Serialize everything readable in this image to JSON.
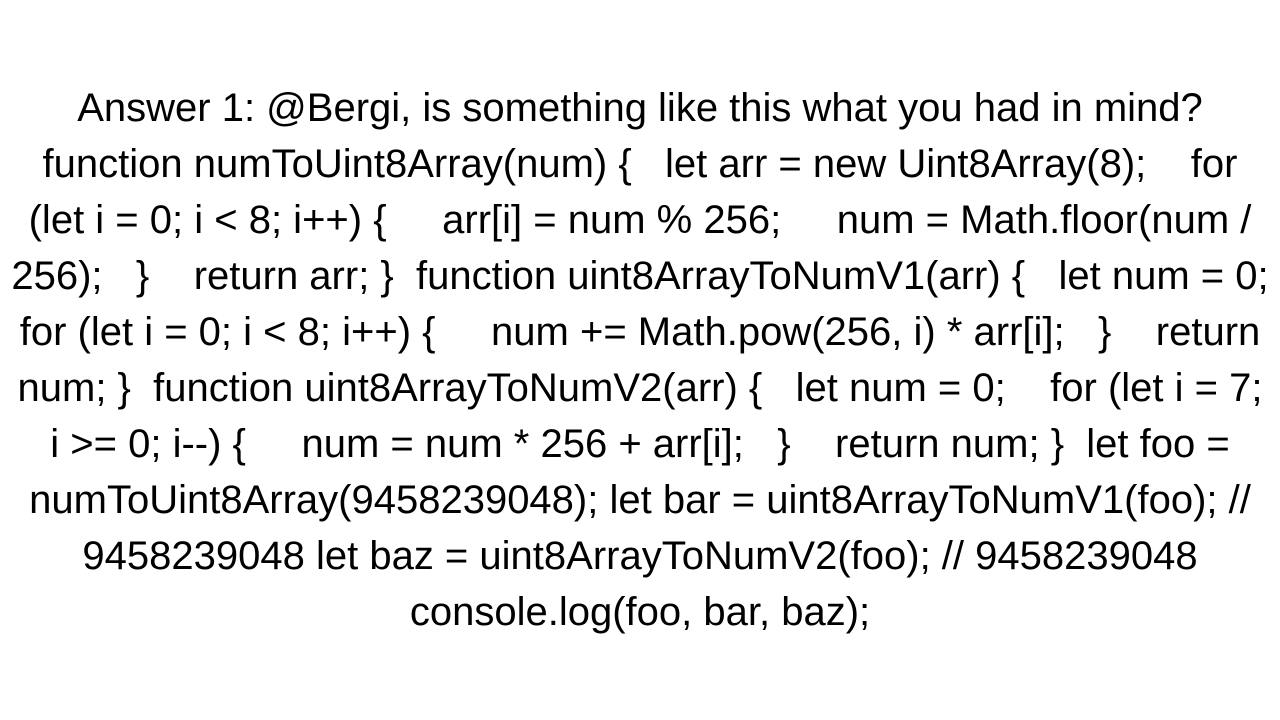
{
  "answer": {
    "prefix": "Answer 1: ",
    "text": "@Bergi, is something like this what you had in mind?   function numToUint8Array(num) {   let arr = new Uint8Array(8);    for (let i = 0; i < 8; i++) {     arr[i] = num % 256;     num = Math.floor(num / 256);   }    return arr; }  function uint8ArrayToNumV1(arr) {   let num = 0;    for (let i = 0; i < 8; i++) {     num += Math.pow(256, i) * arr[i];   }    return num; }  function uint8ArrayToNumV2(arr) {   let num = 0;    for (let i = 7; i >= 0; i--) {     num = num * 256 + arr[i];   }    return num; }  let foo = numToUint8Array(9458239048); let bar = uint8ArrayToNumV1(foo); // 9458239048 let baz = uint8ArrayToNumV2(foo); // 9458239048  console.log(foo, bar, baz);"
  }
}
